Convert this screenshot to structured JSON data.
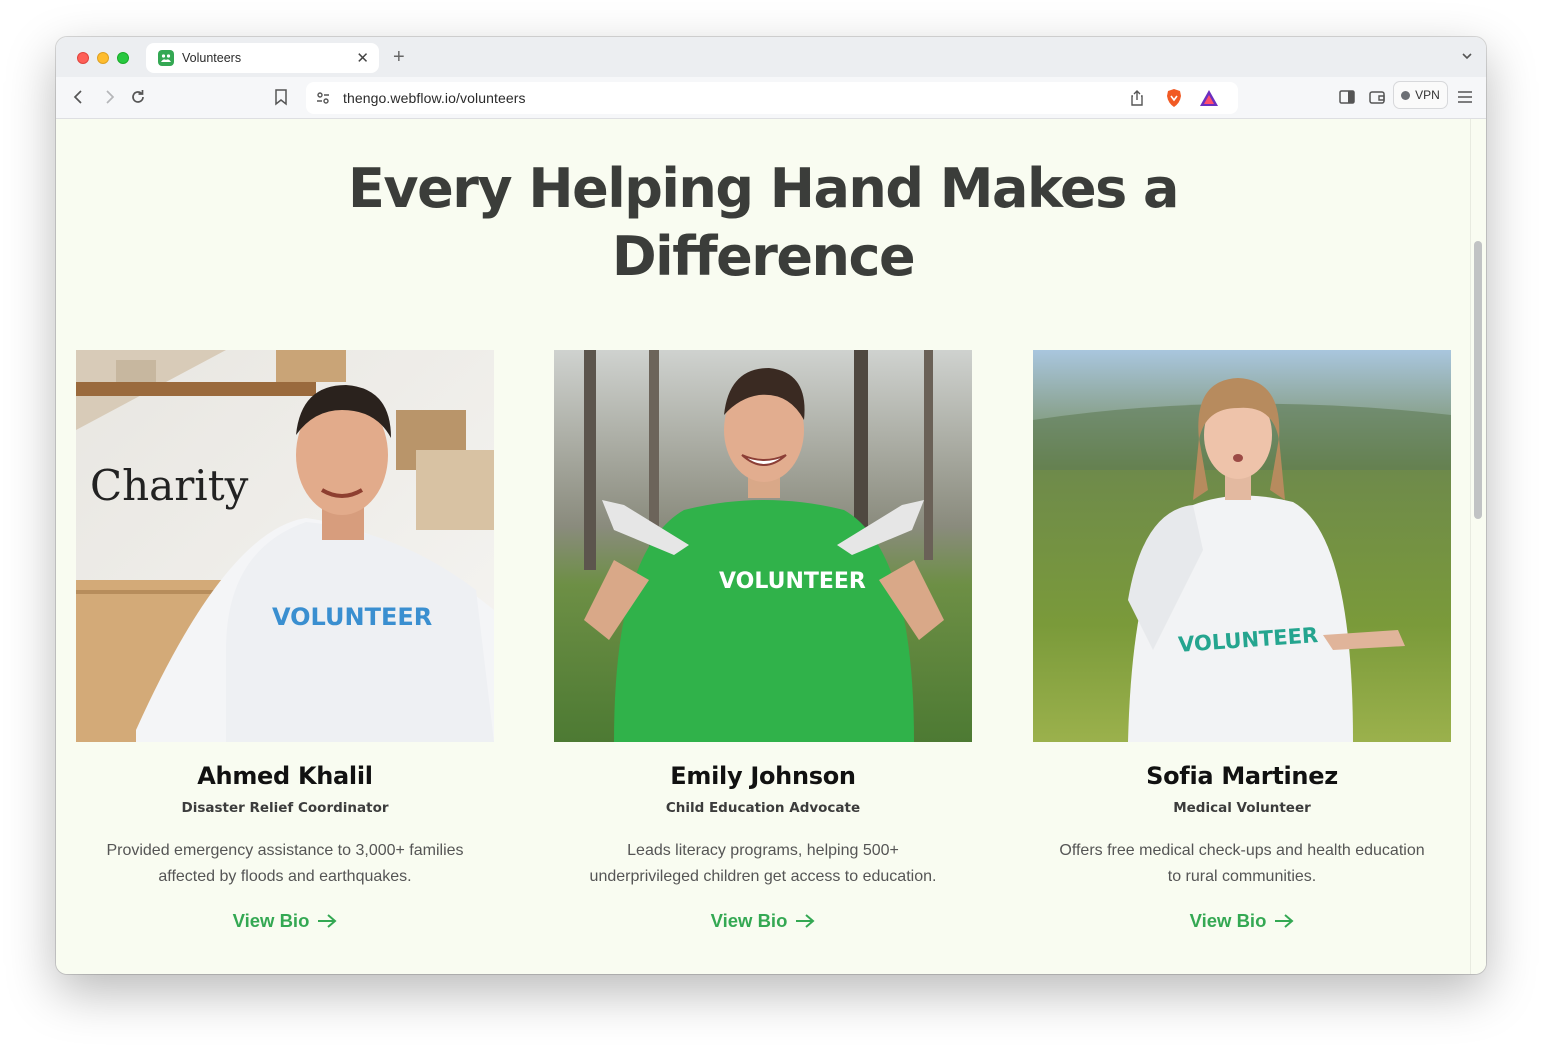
{
  "browser": {
    "tab_title": "Volunteers",
    "url": "thengo.webflow.io/volunteers",
    "vpn_label": "VPN",
    "accent_color": "#34a853"
  },
  "page": {
    "headline": "Every Helping Hand Makes a Difference",
    "volunteers": [
      {
        "name": "Ahmed Khalil",
        "role": "Disaster Relief Coordinator",
        "description": "Provided emergency assistance to 3,000+ families affected by floods and earthquakes.",
        "link_label": "View Bio",
        "photo_text_wall": "Charity",
        "photo_text_shirt": "VOLUNTEER"
      },
      {
        "name": "Emily Johnson",
        "role": "Child Education Advocate",
        "description": "Leads literacy programs, helping 500+ underprivileged children get access to education.",
        "link_label": "View Bio",
        "photo_text_shirt": "VOLUNTEER"
      },
      {
        "name": "Sofia Martinez",
        "role": "Medical Volunteer",
        "description": "Offers free medical check-ups and health education to rural communities.",
        "link_label": "View Bio",
        "photo_text_shirt": "VOLUNTEER"
      }
    ]
  }
}
